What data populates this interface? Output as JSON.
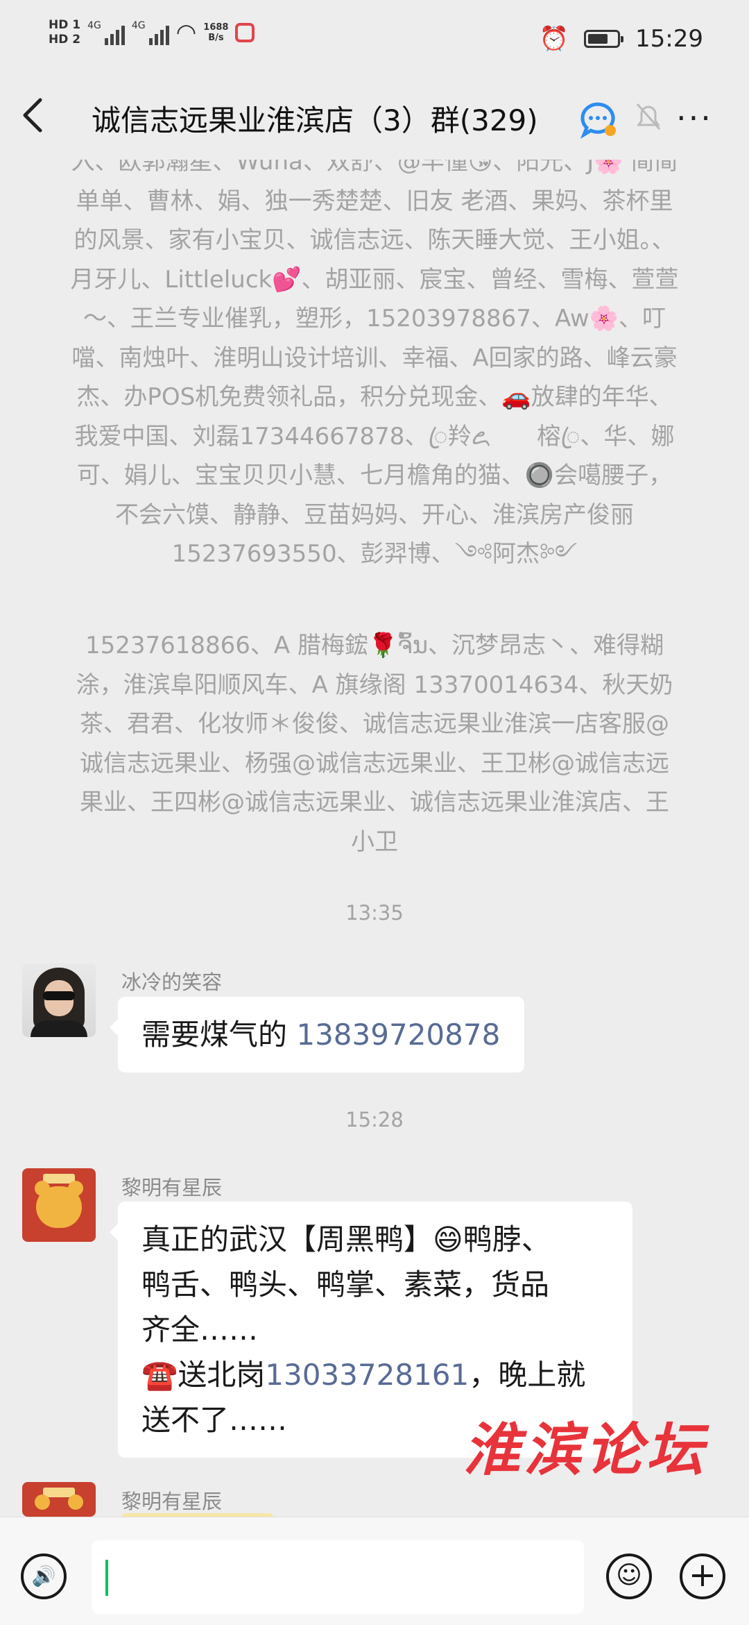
{
  "status_bar": {
    "hd1": "HD 1",
    "hd2": "HD 2",
    "sig1_label": "4G",
    "sig2_label": "4G",
    "speed_top": "1688",
    "speed_bottom": "B/s",
    "time": "15:29",
    "icons": [
      "signal-icon",
      "wifi-icon",
      "app-notification-icon",
      "alarm-icon",
      "battery-icon"
    ]
  },
  "header": {
    "back_icon": "chevron-left",
    "title": "诚信志远果业淮滨店（3）群(329)",
    "icons": [
      "group-chat-icon",
      "mute-bell-icon",
      "more-icon"
    ],
    "more": "···"
  },
  "system_notice": {
    "part1": "入、欧郭瀚星、Wuna、双舒、@丰憧😘、阳光、J🌸 简简单单、曹林、娟、独一秀楚楚、旧友 老酒、果妈、茶杯里的风景、家有小宝贝、诚信志远、陈天睡大觉、王小姐。、月牙儿、Littleluck💕、胡亚丽、宸宝、曾经、雪梅、萱萱～、王兰专业催乳，塑形，15203978867、Aw🌸、叮噹、南烛叶、淮明山设计培训、幸福、A回家的路、峰云豪杰、办POS机免费领礼品，积分兑现金、🚗放肆的年华、我爱中国、刘磊17344667878、ꦿ羚ꦌ　　榕ꦿ、华、娜可、娟儿、宝宝贝贝小慧、七月檐角的猫、🔘会噶腰子，不会六馍、静静、豆苗妈妈、开心、淮滨房产俊丽15237693550、彭羿博、༺阿杰༻",
    "part2": "15237618866、A  腊梅鋐🌹ຈົ້ນ、沉梦昂志丶、难得糊涂，淮滨阜阳顺风车、A  旗缘阁 13370014634、秋天奶茶、君君、化妆师＊俊俊、诚信志远果业淮滨一店客服@诚信志远果业、杨强@诚信志远果业、王卫彬@诚信志远果业、王四彬@诚信志远果业、诚信志远果业淮滨店、王小卫"
  },
  "messages": [
    {
      "time": "13:35",
      "sender": "冰冷的笑容",
      "text": "需要煤气的 ",
      "phone": "13839720878",
      "avatar_icon": "woman-sunglasses-avatar"
    },
    {
      "time": "15:28",
      "sender": "黎明有星辰",
      "line1": "真正的武汉【周黑鸭】😄鸭脖、",
      "line2": "鸭舌、鸭头、鸭掌、素菜，货品",
      "line3": "齐全……",
      "line4a": "☎️送北岗",
      "phone": "13033728161",
      "line4b": "，晚上就",
      "line5": "送不了……",
      "avatar_icon": "pooh-bear-avatar"
    },
    {
      "sender": "黎明有星辰",
      "avatar_icon": "pooh-bear-avatar"
    }
  ],
  "watermark": "淮滨论坛",
  "input_bar": {
    "voice_icon": "🔊",
    "emoji_icon": "☺",
    "plus_icon": "+",
    "text": ""
  },
  "colors": {
    "background": "#ededed",
    "link": "#576b95",
    "cursor": "#07c160",
    "watermark": "#e8333a"
  }
}
